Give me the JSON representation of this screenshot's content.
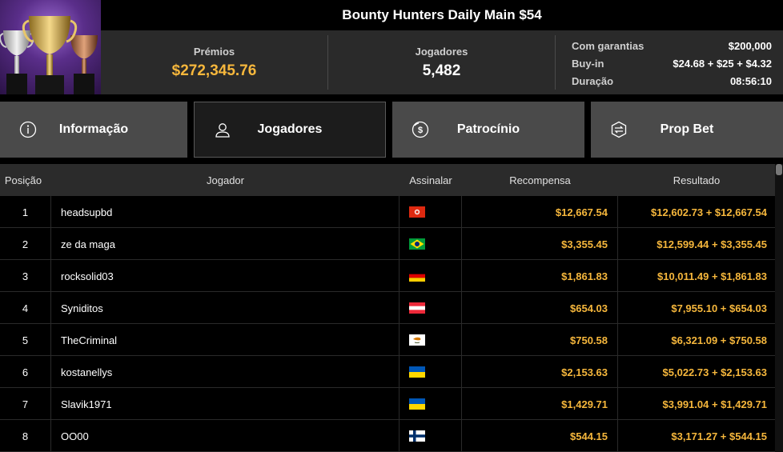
{
  "tournament": {
    "title": "Bounty Hunters Daily Main $54"
  },
  "stats": {
    "prizes_label": "Prémios",
    "prizes_value": "$272,345.76",
    "players_label": "Jogadores",
    "players_value": "5,482",
    "details": [
      {
        "label": "Com garantias",
        "value": "$200,000"
      },
      {
        "label": "Buy-in",
        "value": "$24.68 + $25 + $4.32"
      },
      {
        "label": "Duração",
        "value": "08:56:10"
      }
    ]
  },
  "tabs": [
    {
      "label": "Informação",
      "icon": "info-icon"
    },
    {
      "label": "Jogadores",
      "icon": "user-icon",
      "active": true
    },
    {
      "label": "Patrocínio",
      "icon": "dollar-coin-icon"
    },
    {
      "label": "Prop Bet",
      "icon": "prop-bet-icon"
    }
  ],
  "table": {
    "headers": {
      "position": "Posição",
      "player": "Jogador",
      "flag": "Assinalar",
      "reward": "Recompensa",
      "result": "Resultado"
    },
    "rows": [
      {
        "position": "1",
        "player": "headsupbd",
        "country": "hong-kong",
        "reward": "$12,667.54",
        "result": "$12,602.73 + $12,667.54"
      },
      {
        "position": "2",
        "player": "ze da maga",
        "country": "brazil",
        "reward": "$3,355.45",
        "result": "$12,599.44 + $3,355.45"
      },
      {
        "position": "3",
        "player": "rocksolid03",
        "country": "germany",
        "reward": "$1,861.83",
        "result": "$10,011.49 + $1,861.83"
      },
      {
        "position": "4",
        "player": "Syniditos",
        "country": "austria",
        "reward": "$654.03",
        "result": "$7,955.10 + $654.03"
      },
      {
        "position": "5",
        "player": "TheCriminal",
        "country": "cyprus",
        "reward": "$750.58",
        "result": "$6,321.09 + $750.58"
      },
      {
        "position": "6",
        "player": "kostanellys",
        "country": "ukraine",
        "reward": "$2,153.63",
        "result": "$5,022.73 + $2,153.63"
      },
      {
        "position": "7",
        "player": "Slavik1971",
        "country": "ukraine",
        "reward": "$1,429.71",
        "result": "$3,991.04 + $1,429.71"
      },
      {
        "position": "8",
        "player": "OO00",
        "country": "finland",
        "reward": "$544.15",
        "result": "$3,171.27 + $544.15"
      }
    ]
  },
  "colors": {
    "accent": "#f6b73c",
    "header_bg": "#2a2a2a",
    "tab_bg": "#4a4a4a",
    "tab_active_bg": "#1c1c1c"
  }
}
